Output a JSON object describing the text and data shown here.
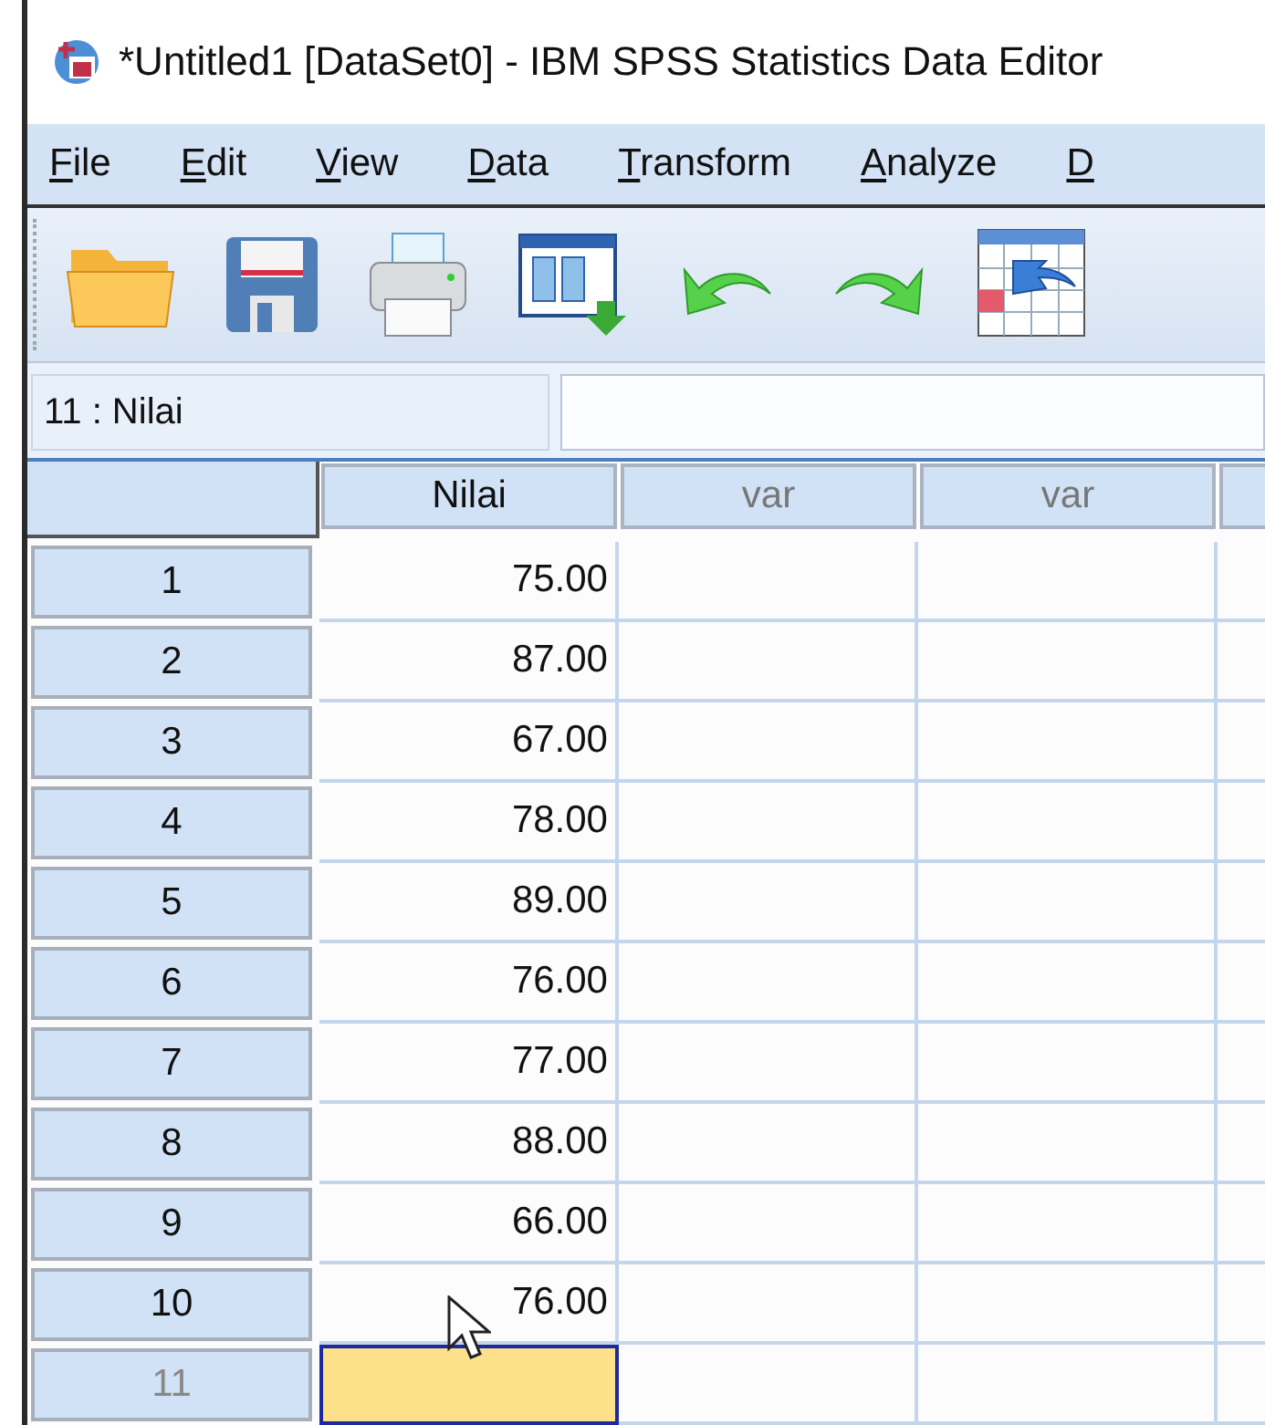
{
  "window": {
    "title": "*Untitled1 [DataSet0] - IBM SPSS Statistics Data Editor"
  },
  "menu": [
    "File",
    "Edit",
    "View",
    "Data",
    "Transform",
    "Analyze",
    "D"
  ],
  "cell_reference": {
    "label": "11 : Nilai"
  },
  "table": {
    "columns": [
      {
        "name": "Nilai",
        "defined": true
      },
      {
        "name": "var",
        "defined": false
      },
      {
        "name": "var",
        "defined": false
      }
    ],
    "rows": [
      {
        "number": "1",
        "value": "75.00",
        "defined": true,
        "selected": false
      },
      {
        "number": "2",
        "value": "87.00",
        "defined": true,
        "selected": false
      },
      {
        "number": "3",
        "value": "67.00",
        "defined": true,
        "selected": false
      },
      {
        "number": "4",
        "value": "78.00",
        "defined": true,
        "selected": false
      },
      {
        "number": "5",
        "value": "89.00",
        "defined": true,
        "selected": false
      },
      {
        "number": "6",
        "value": "76.00",
        "defined": true,
        "selected": false
      },
      {
        "number": "7",
        "value": "77.00",
        "defined": true,
        "selected": false
      },
      {
        "number": "8",
        "value": "88.00",
        "defined": true,
        "selected": false
      },
      {
        "number": "9",
        "value": "66.00",
        "defined": true,
        "selected": false
      },
      {
        "number": "10",
        "value": "76.00",
        "defined": true,
        "selected": false
      },
      {
        "number": "11",
        "defined": false,
        "selected": true
      }
    ]
  }
}
